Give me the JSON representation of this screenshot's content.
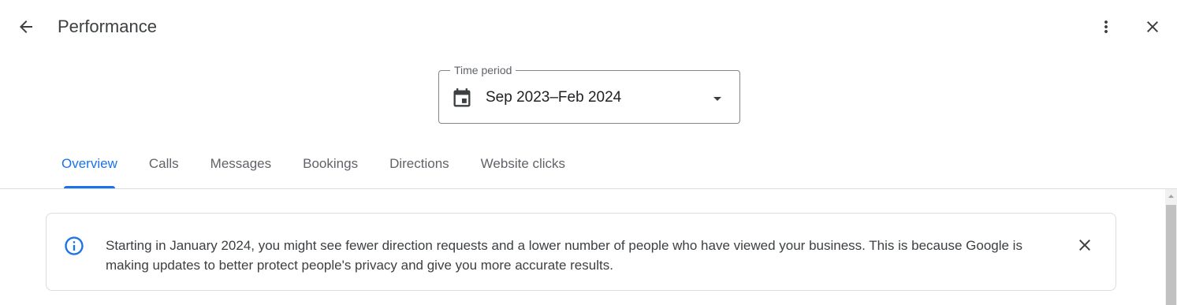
{
  "header": {
    "title": "Performance",
    "back_icon": "arrow-back-icon",
    "more_icon": "more-vert-icon",
    "close_icon": "close-icon"
  },
  "time_period": {
    "label": "Time period",
    "value": "Sep 2023–Feb 2024",
    "icon": "calendar-icon",
    "dropdown_icon": "arrow-drop-down-icon"
  },
  "tabs": [
    {
      "label": "Overview",
      "active": true
    },
    {
      "label": "Calls",
      "active": false
    },
    {
      "label": "Messages",
      "active": false
    },
    {
      "label": "Bookings",
      "active": false
    },
    {
      "label": "Directions",
      "active": false
    },
    {
      "label": "Website clicks",
      "active": false
    }
  ],
  "banner": {
    "icon": "info-icon",
    "text": "Starting in January 2024, you might see fewer direction requests and a lower number of people who have viewed your business. This is because Google is making updates to better protect people's privacy and give you more accurate results.",
    "close_icon": "close-icon"
  },
  "colors": {
    "accent": "#1a73e8",
    "text_primary": "#202124",
    "text_secondary": "#5f6368",
    "border": "#dadce0"
  }
}
